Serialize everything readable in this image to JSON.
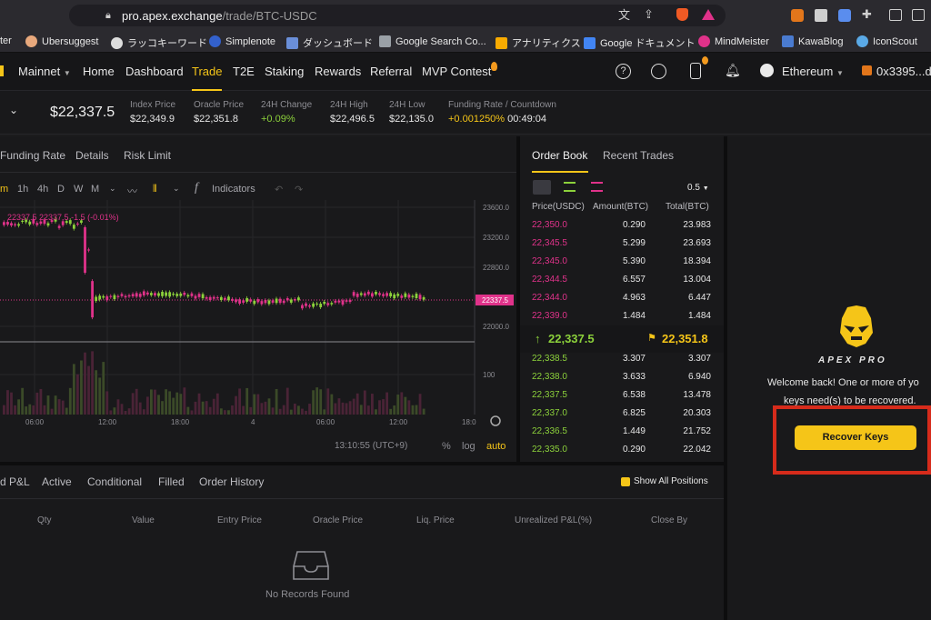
{
  "browser": {
    "url_host": "pro.apex.exchange",
    "url_path": "/trade/BTC-USDC",
    "bookmarks": [
      "ter",
      "Ubersuggest",
      "ラッコキーワード",
      "Simplenote",
      "ダッシュボード",
      "Google Search Co...",
      "アナリティクス",
      "Google ドキュメント",
      "MindMeister",
      "KawaBlog",
      "IconScout"
    ]
  },
  "header": {
    "network": "Mainnet",
    "nav": [
      "Home",
      "Dashboard",
      "Trade",
      "T2E",
      "Staking",
      "Rewards",
      "Referral",
      "MVP Contest"
    ],
    "active_nav": "Trade",
    "chain": "Ethereum",
    "wallet": "0x3395...d"
  },
  "ticker": {
    "price": "$22,337.5",
    "stats": [
      {
        "label": "Index Price",
        "value": "$22,349.9"
      },
      {
        "label": "Oracle Price",
        "value": "$22,351.8"
      },
      {
        "label": "24H Change",
        "value": "+0.09%"
      },
      {
        "label": "24H High",
        "value": "$22,496.5"
      },
      {
        "label": "24H Low",
        "value": "$22,135.0"
      },
      {
        "label": "Funding Rate / Countdown",
        "value": "+0.001250%",
        "value2": "00:49:04"
      }
    ]
  },
  "chart": {
    "tabs": [
      "Funding Rate",
      "Details",
      "Risk Limit"
    ],
    "intervals": [
      "m",
      "1h",
      "4h",
      "D",
      "W",
      "M"
    ],
    "indicators_label": "Indicators",
    "legend": "22337.5 22337.5  -1.5 (-0.01%)",
    "price_ticks": [
      "23600.0",
      "23200.0",
      "22800.0",
      "22000.0"
    ],
    "last_price_tag": "22337.5",
    "volume_tick": "100",
    "time_ticks": [
      "06:00",
      "12:00",
      "18:00",
      "4",
      "06:00",
      "12:00",
      "18:0"
    ],
    "clock": "13:10:55 (UTC+9)",
    "scale_options": [
      "%",
      "log",
      "auto"
    ],
    "colors": {
      "up": "#8cd13b",
      "down": "#e0328a"
    }
  },
  "orderbook": {
    "tabs": [
      "Order Book",
      "Recent Trades"
    ],
    "precision": "0.5",
    "headers": [
      "Price(USDC)",
      "Amount(BTC)",
      "Total(BTC)"
    ],
    "asks": [
      [
        "22,350.0",
        "0.290",
        "23.983"
      ],
      [
        "22,345.5",
        "5.299",
        "23.693"
      ],
      [
        "22,345.0",
        "5.390",
        "18.394"
      ],
      [
        "22,344.5",
        "6.557",
        "13.004"
      ],
      [
        "22,344.0",
        "4.963",
        "6.447"
      ],
      [
        "22,339.0",
        "1.484",
        "1.484"
      ]
    ],
    "last_price": "22,337.5",
    "mark_price": "22,351.8",
    "bids": [
      [
        "22,338.5",
        "3.307",
        "3.307"
      ],
      [
        "22,338.0",
        "3.633",
        "6.940"
      ],
      [
        "22,337.5",
        "6.538",
        "13.478"
      ],
      [
        "22,337.0",
        "6.825",
        "20.303"
      ],
      [
        "22,336.5",
        "1.449",
        "21.752"
      ],
      [
        "22,335.0",
        "0.290",
        "22.042"
      ]
    ]
  },
  "positions": {
    "tabs": [
      "d P&L",
      "Active",
      "Conditional",
      "Filled",
      "Order History"
    ],
    "show_all": "Show All Positions",
    "columns": [
      "Qty",
      "Value",
      "Entry Price",
      "Oracle Price",
      "Liq. Price",
      "Unrealized P&L(%)",
      "Close By"
    ],
    "empty": "No Records Found"
  },
  "right_panel": {
    "brand": "APEX PRO",
    "message_line1": "Welcome back! One or more of yo",
    "message_line2": "keys need(s) to be recovered.",
    "button": "Recover Keys"
  }
}
